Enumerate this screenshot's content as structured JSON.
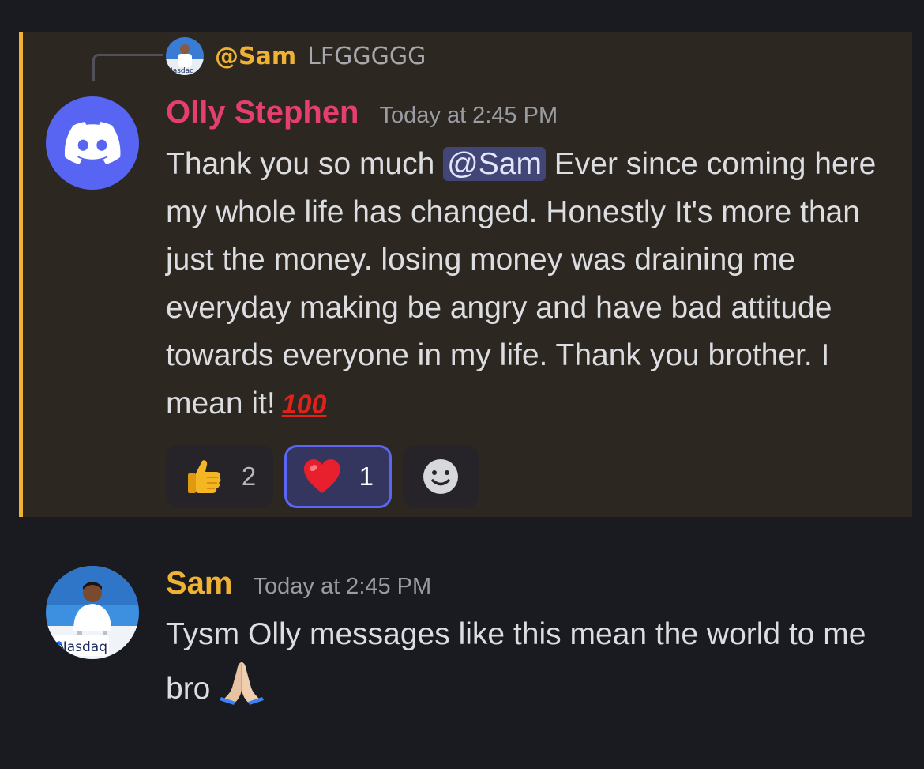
{
  "reply": {
    "mention": "@Sam",
    "text": "LFGGGGG",
    "avatar_badge": "Nasdaq"
  },
  "message_olly": {
    "author": "Olly Stephen",
    "author_color": "#e43f6f",
    "timestamp": "Today at 2:45 PM",
    "text_before_mention": "Thank you so much ",
    "mention": "@Sam",
    "text_after_mention": "  Ever since coming here my whole life has changed. Honestly It's more than just the money. losing money was draining me everyday making be angry and have bad attitude towards everyone in my life. Thank you brother. I mean it!",
    "emoji_end": "100",
    "avatar_icon": "discord-logo-icon"
  },
  "reactions": [
    {
      "icon": "thumbs-up-icon",
      "count": "2",
      "active": false
    },
    {
      "icon": "red-heart-icon",
      "count": "1",
      "active": true
    },
    {
      "icon": "add-reaction-icon",
      "count": "",
      "active": false
    }
  ],
  "message_sam": {
    "author": "Sam",
    "author_color": "#f0b232",
    "timestamp": "Today at 2:45 PM",
    "text": "Tysm Olly messages like this mean the world to me bro",
    "emoji_end": "folded-hands-icon",
    "avatar_badge": "Nasdaq"
  },
  "colors": {
    "background": "#1a1b20",
    "highlight_background": "#2d2722",
    "highlight_bar": "#f0b232",
    "mention_bg": "#414676",
    "reaction_active_border": "#5b66f5"
  }
}
